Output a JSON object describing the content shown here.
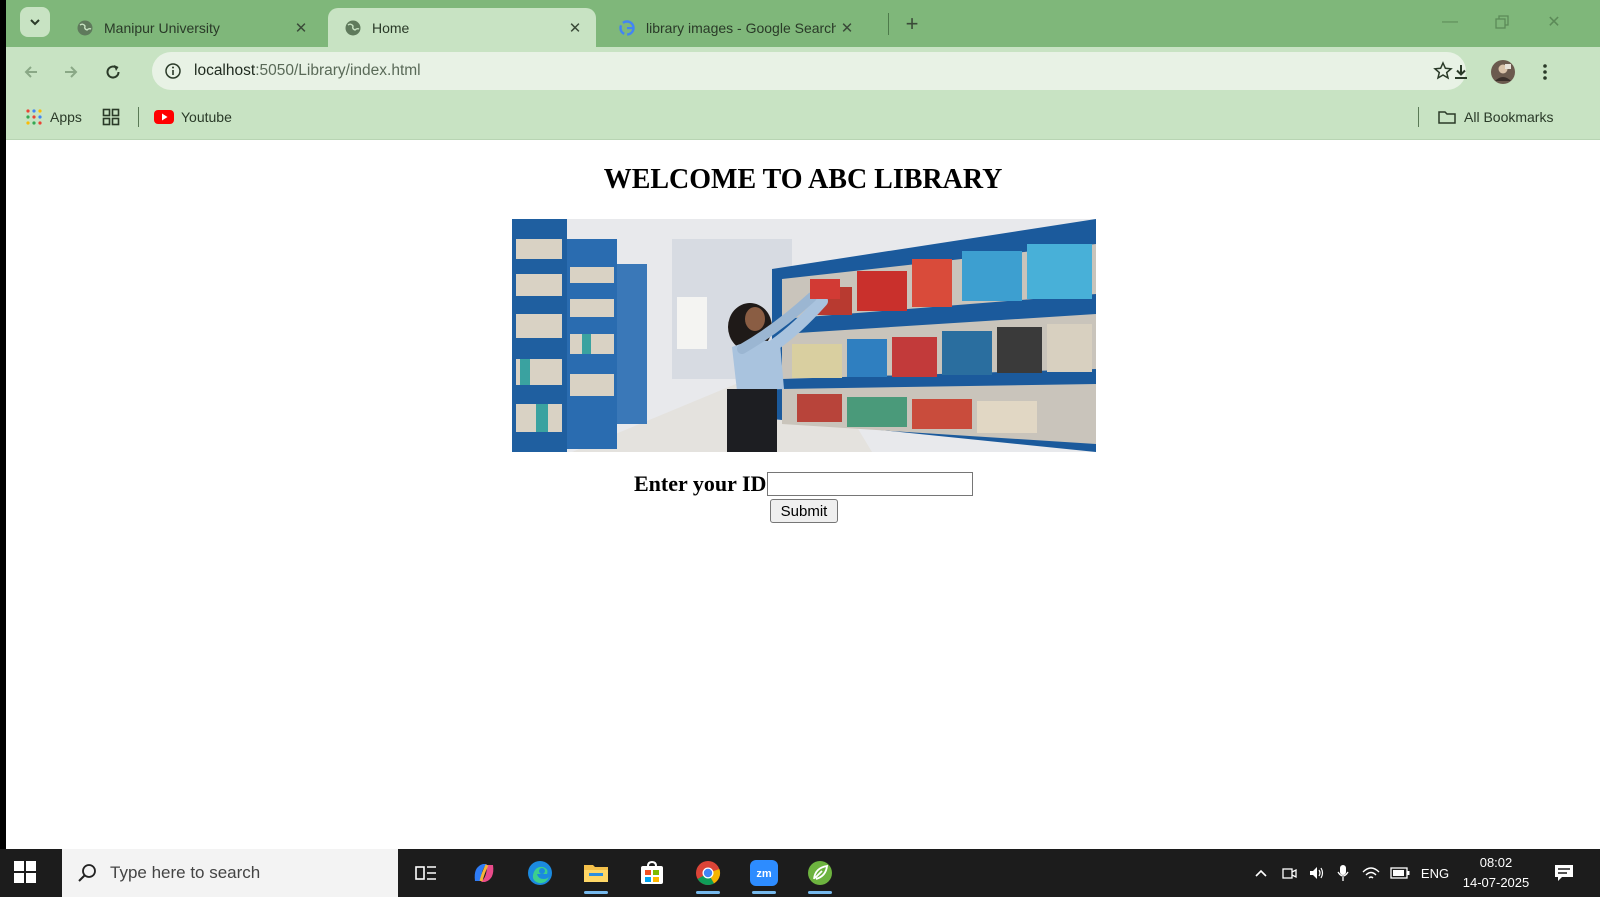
{
  "browser": {
    "tabs": [
      {
        "title": "Manipur University",
        "icon": "globe-icon",
        "active": false
      },
      {
        "title": "Home",
        "icon": "globe-icon",
        "active": true
      },
      {
        "title": "library images - Google Search",
        "icon": "google-g-icon",
        "active": false
      }
    ],
    "address": {
      "host": "localhost",
      "path": ":5050/Library/index.html"
    },
    "bookmarks": {
      "apps_label": "Apps",
      "youtube_label": "Youtube",
      "all_bookmarks_label": "All Bookmarks"
    }
  },
  "page": {
    "heading": "WELCOME TO ABC LIBRARY",
    "form": {
      "id_label": "Enter your ID",
      "id_value": "",
      "submit_label": "Submit"
    }
  },
  "taskbar": {
    "search_placeholder": "Type here to search",
    "language": "ENG",
    "time": "08:02",
    "date": "14-07-2025"
  },
  "colors": {
    "chrome": "#7fb77a",
    "toolbar": "#c8e3c3",
    "taskbar": "#1c1c1c"
  }
}
